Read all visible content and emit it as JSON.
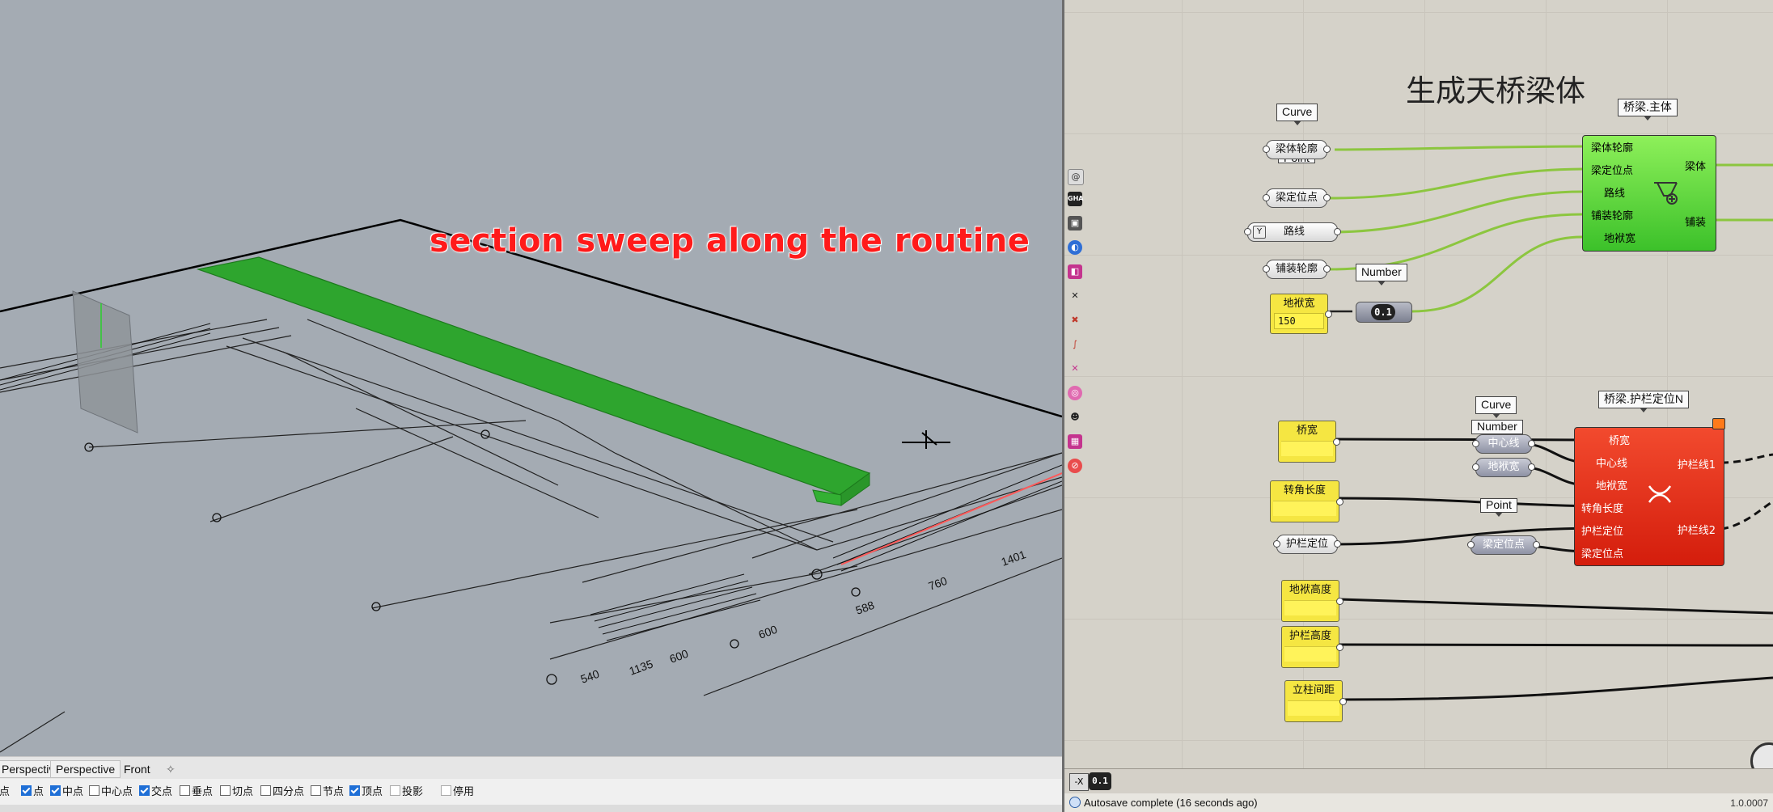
{
  "viewport": {
    "overlay_text": "section sweep along the routine",
    "tabs": [
      "Perspective",
      "Perspective",
      "Front"
    ],
    "add_tab_icon": "plus-icon",
    "snaps": [
      {
        "label": "端点",
        "checked": false
      },
      {
        "label": "点",
        "checked": true
      },
      {
        "label": "中点",
        "checked": true
      },
      {
        "label": "中心点",
        "checked": false
      },
      {
        "label": "交点",
        "checked": true
      },
      {
        "label": "垂点",
        "checked": false
      },
      {
        "label": "切点",
        "checked": false
      },
      {
        "label": "四分点",
        "checked": false
      },
      {
        "label": "节点",
        "checked": false
      },
      {
        "label": "顶点",
        "checked": true
      },
      {
        "label": "投影",
        "checked": false
      },
      {
        "label": "停用",
        "checked": false
      }
    ]
  },
  "grasshopper": {
    "title": "生成天桥梁体",
    "tags": {
      "curve1": "Curve",
      "point1": "Point",
      "number1": "Number",
      "main_comp": "桥梁.主体",
      "curve2": "Curve",
      "number2": "Number",
      "guard_comp": "桥梁.护栏定位N",
      "point2": "Point"
    },
    "params_top": [
      "梁体轮廓",
      "梁定位点",
      "路线",
      "铺装轮廓"
    ],
    "slab_width": {
      "label": "地袱宽",
      "value": "150"
    },
    "slider_value": "0.1",
    "main_component": {
      "inputs": [
        "梁体轮廓",
        "梁定位点",
        "路线",
        "铺装轮廓",
        "地袱宽"
      ],
      "outputs": [
        "梁体",
        "铺装"
      ]
    },
    "lower_panels": [
      "桥宽",
      "转角长度",
      "地袱高度",
      "护栏高度",
      "立柱间距"
    ],
    "guard_param": "护栏定位",
    "grey_params": [
      "中心线",
      "地袱宽",
      "梁定位点"
    ],
    "guard_component": {
      "inputs": [
        "桥宽",
        "中心线",
        "地袱宽",
        "转角长度",
        "护栏定位",
        "梁定位点"
      ],
      "outputs": [
        "护栏线1",
        "护栏线2"
      ]
    },
    "bottom_left_badge": "0.1",
    "status_text": "Autosave complete (16 seconds ago)",
    "version": "1.0.0007"
  },
  "colors": {
    "viewport_bg": "#a4abb3",
    "beam_green": "#2ea52e",
    "component_green": "#63d43d",
    "component_red": "#e02a12",
    "panel_yellow": "#f5e642",
    "wire_green": "#8cc63f",
    "overlay_red": "#ff1a1a"
  }
}
